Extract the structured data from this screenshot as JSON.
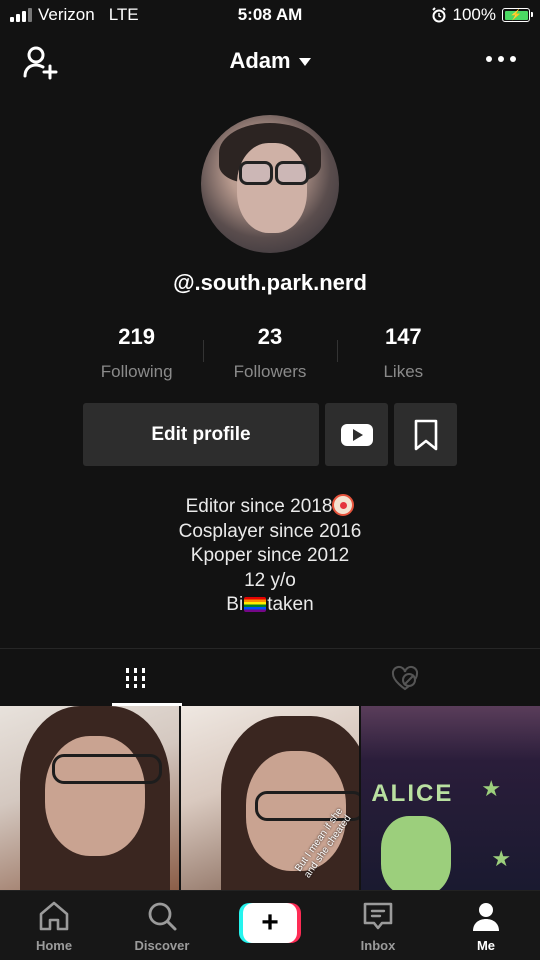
{
  "status_bar": {
    "carrier": "Verizon",
    "network": "LTE",
    "time": "5:08 AM",
    "battery": "100%"
  },
  "header": {
    "title": "Adam"
  },
  "profile": {
    "username": "@.south.park.nerd",
    "stats": [
      {
        "value": "219",
        "label": "Following"
      },
      {
        "value": "23",
        "label": "Followers"
      },
      {
        "value": "147",
        "label": "Likes"
      }
    ],
    "edit_label": "Edit profile",
    "bio": {
      "line1": "Editor since 2018",
      "line2": "Cosplayer since 2016",
      "line3": "Kpoper since 2012",
      "line4": "12 y/o",
      "line5_before": "Bi",
      "line5_after": "taken"
    }
  },
  "videos": {
    "caption2": "But I mean if she and she cheated",
    "shirt_text": "ALICE"
  },
  "nav": {
    "home": "Home",
    "discover": "Discover",
    "create": "+",
    "inbox": "Inbox",
    "me": "Me"
  },
  "colors": {
    "background": "#121212",
    "button": "#2d2d2d",
    "create_cyan": "#25f4ee",
    "create_pink": "#fe2c55"
  }
}
